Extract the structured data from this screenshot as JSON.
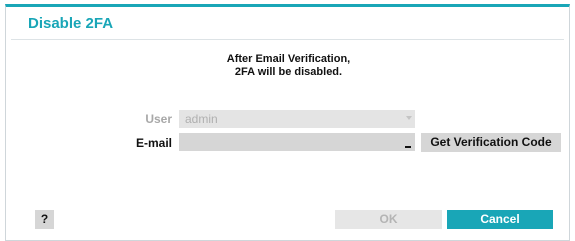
{
  "dialog": {
    "title": "Disable 2FA",
    "message_line1": "After Email Verification,",
    "message_line2": "2FA will be disabled."
  },
  "form": {
    "user_label": "User",
    "user_value": "admin",
    "email_label": "E-mail",
    "email_value": "",
    "verify_button": "Get Verification Code"
  },
  "footer": {
    "help_button": "?",
    "ok_button": "OK",
    "cancel_button": "Cancel"
  },
  "colors": {
    "accent": "#19a6b7",
    "field_bg": "#d6d6d6",
    "disabled_text": "#b4b4b4"
  },
  "icons": {
    "dropdown": "chevron-down-icon",
    "help": "help-icon"
  }
}
